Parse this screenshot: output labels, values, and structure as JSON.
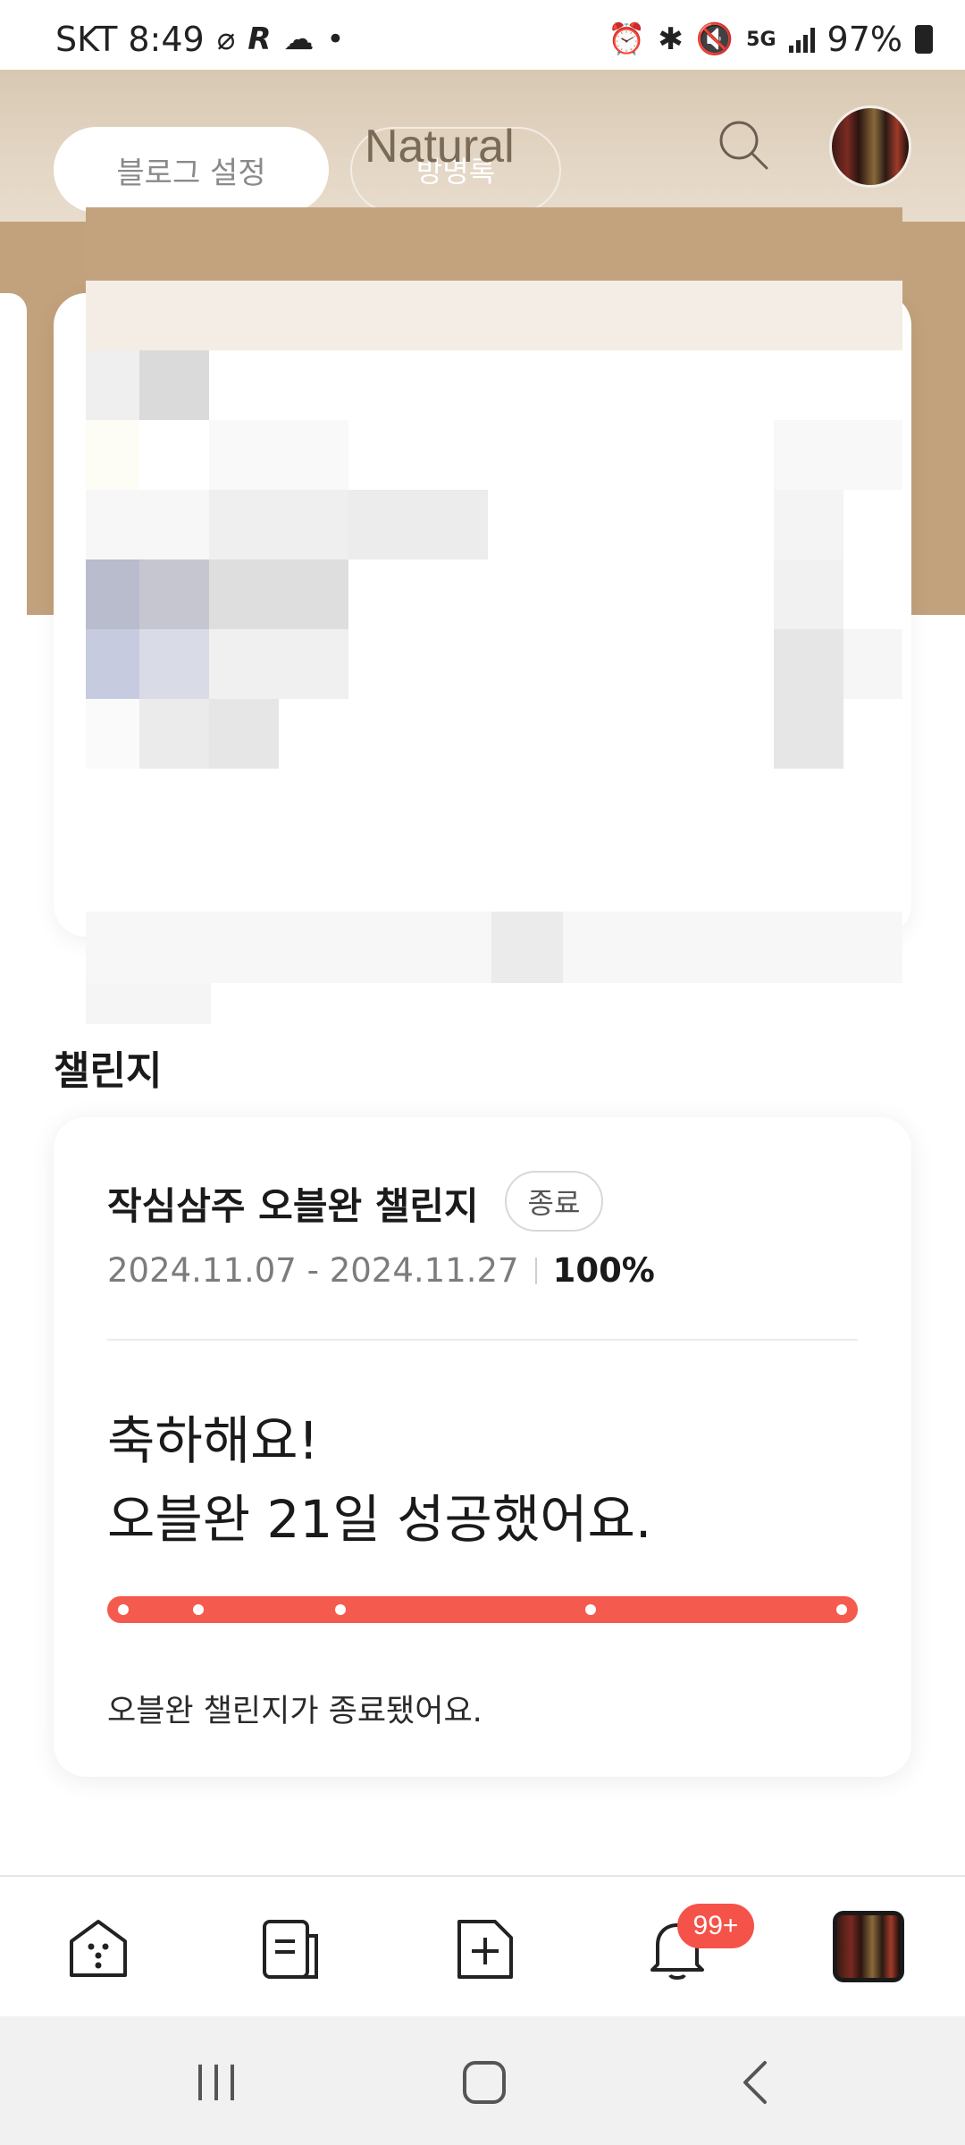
{
  "status_bar": {
    "carrier_time": "SKT 8:49",
    "icons_left": [
      "link-icon",
      "r-app-icon",
      "cloud-icon",
      "dot-icon"
    ],
    "icons_right": [
      "alarm-icon",
      "bluetooth-icon",
      "mute-icon",
      "5g-icon",
      "signal-icon"
    ],
    "battery": "97%"
  },
  "header": {
    "blog_settings_label": "블로그 설정",
    "guestbook_label": "방명록",
    "blog_title": "Natural"
  },
  "challenge_section": {
    "title": "챌린지",
    "card": {
      "name": "작심삼주 오블완 챌린지",
      "badge": "종료",
      "date_range": "2024.11.07 - 2024.11.27",
      "progress_text": "100%",
      "progress_value": 1.0,
      "congrats_line1": "축하해요!",
      "congrats_line2": "오블완 21일 성공했어요.",
      "footer": "오블완 챌린지가 종료됐어요.",
      "accent_color": "#f55a4e"
    }
  },
  "bottom_nav": {
    "items": [
      "home-icon",
      "posts-icon",
      "new-post-icon",
      "notifications-icon",
      "profile-avatar"
    ],
    "notification_badge": "99+"
  },
  "system_nav": [
    "recents-button",
    "home-button",
    "back-button"
  ]
}
